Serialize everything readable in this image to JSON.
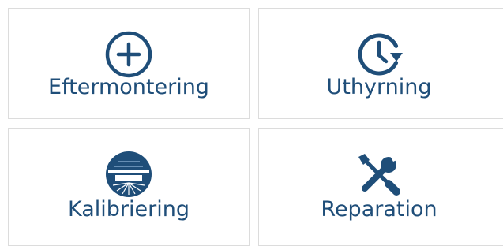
{
  "colors": {
    "icon": "#1f4e79",
    "label": "#1f4e79",
    "tile_border": "#dcdcdc",
    "background": "#ffffff"
  },
  "tiles": [
    {
      "label": "Eftermontering",
      "icon": "plus-circle-icon"
    },
    {
      "label": "Uthyrning",
      "icon": "clock-refresh-icon"
    },
    {
      "label": "Kalibriering",
      "icon": "calibration-seal-icon"
    },
    {
      "label": "Reparation",
      "icon": "wrench-screwdriver-icon"
    }
  ]
}
